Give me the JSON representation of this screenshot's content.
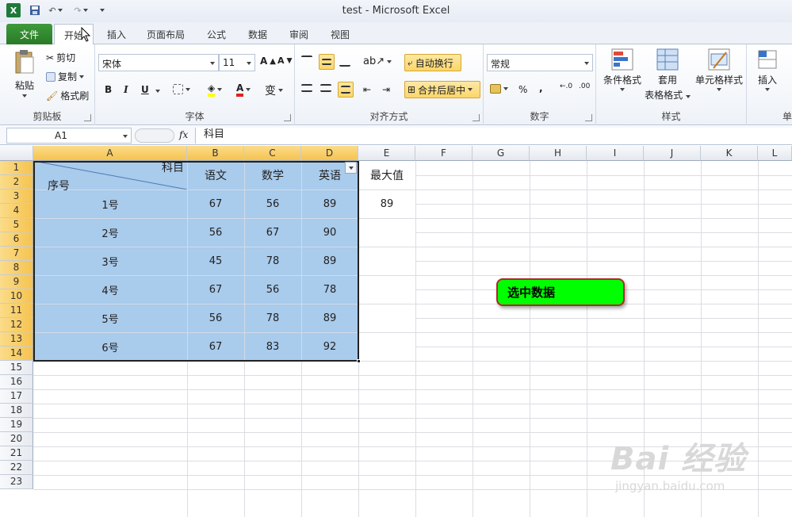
{
  "window": {
    "title": "test  -  Microsoft Excel"
  },
  "tabs": [
    "文件",
    "开始",
    "插入",
    "页面布局",
    "公式",
    "数据",
    "审阅",
    "视图"
  ],
  "ribbon": {
    "clipboard": {
      "paste": "粘贴",
      "cut": "剪切",
      "copy": "复制",
      "format_painter": "格式刷",
      "label": "剪贴板"
    },
    "font": {
      "name": "宋体",
      "size": "11",
      "bold": "B",
      "italic": "I",
      "underline": "U",
      "label": "字体"
    },
    "alignment": {
      "wrap": "自动换行",
      "merge": "合并后居中",
      "label": "对齐方式"
    },
    "number": {
      "format": "常规",
      "percent": "%",
      "comma": ",",
      "inc": "←.0\n.00",
      "label": "数字"
    },
    "styles": {
      "conditional": "条件格式",
      "table1": "套用",
      "table2": "表格格式",
      "cell_styles": "单元格样式",
      "label": "样式"
    },
    "cells": {
      "insert": "插入",
      "label": "单"
    }
  },
  "formula_bar": {
    "name_box": "A1",
    "fx": "fx",
    "content": "科目"
  },
  "columns": [
    "A",
    "B",
    "C",
    "D",
    "E",
    "F",
    "G",
    "H",
    "I",
    "J",
    "K",
    "L"
  ],
  "rows": [
    "1",
    "2",
    "3",
    "4",
    "5",
    "6",
    "7",
    "8",
    "9",
    "10",
    "11",
    "12",
    "13",
    "14",
    "15",
    "16",
    "17",
    "18",
    "19",
    "20",
    "21",
    "22",
    "23"
  ],
  "table": {
    "corner_top": "科目",
    "corner_bottom": "序号",
    "headers": [
      "语文",
      "数学",
      "英语"
    ],
    "max_header": "最大值",
    "records": [
      {
        "id": "1号",
        "values": [
          "67",
          "56",
          "89"
        ],
        "max": "89"
      },
      {
        "id": "2号",
        "values": [
          "56",
          "67",
          "90"
        ],
        "max": ""
      },
      {
        "id": "3号",
        "values": [
          "45",
          "78",
          "89"
        ],
        "max": ""
      },
      {
        "id": "4号",
        "values": [
          "67",
          "56",
          "78"
        ],
        "max": ""
      },
      {
        "id": "5号",
        "values": [
          "56",
          "78",
          "89"
        ],
        "max": ""
      },
      {
        "id": "6号",
        "values": [
          "67",
          "83",
          "92"
        ],
        "max": ""
      }
    ]
  },
  "callout": {
    "text": "选中数据",
    "color": "#00ff00"
  },
  "watermark": {
    "brand": "Bai 经验",
    "url": "jingyan.baidu.com"
  },
  "accent": "#2a7a28"
}
